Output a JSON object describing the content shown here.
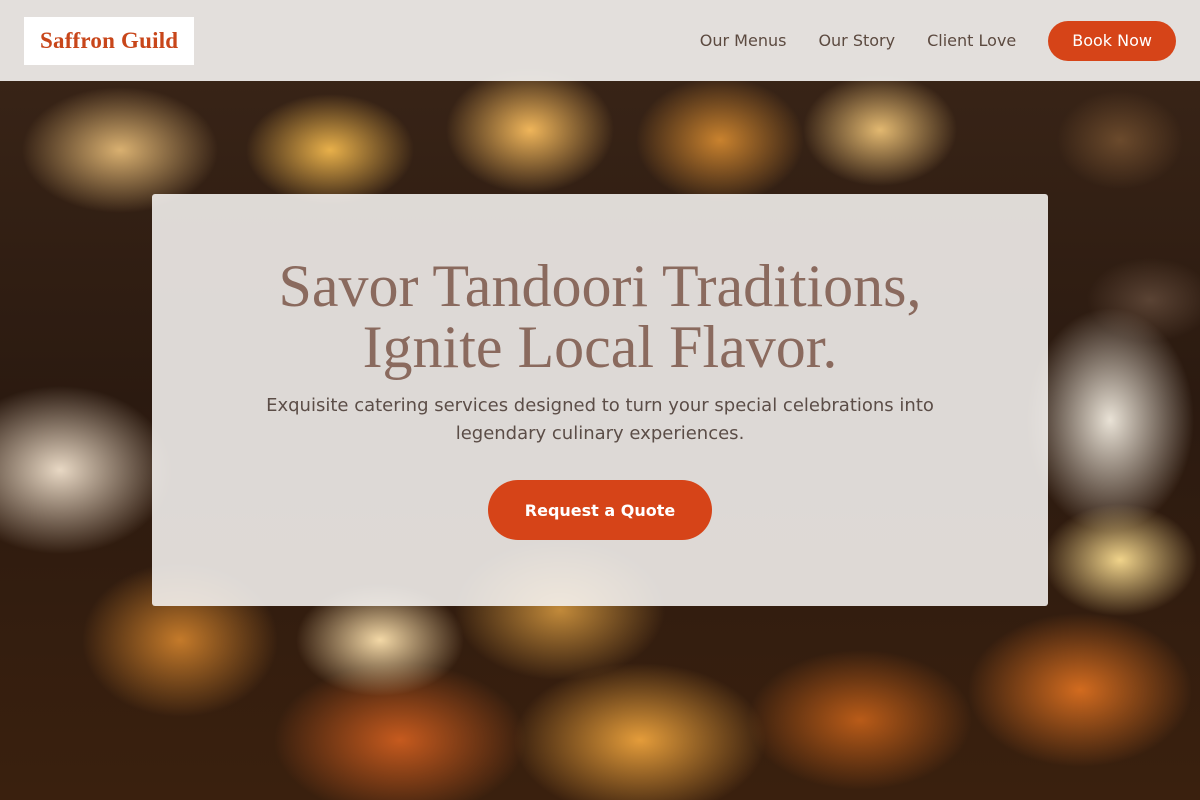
{
  "header": {
    "logo": "Saffron Guild",
    "nav": [
      {
        "label": "Our Menus"
      },
      {
        "label": "Our Story"
      },
      {
        "label": "Client Love"
      }
    ],
    "cta_label": "Book Now"
  },
  "hero": {
    "title_line1": "Savor Tandoori Traditions,",
    "title_line2": "Ignite Local Flavor.",
    "subtitle": "Exquisite catering services designed to turn your special celebrations into legendary culinary experiences.",
    "cta_label": "Request a Quote",
    "background_image": "catering-food-platter-photo"
  },
  "colors": {
    "accent": "#d64418",
    "logo": "#c8461a",
    "heading": "#8a6a5e",
    "body_text": "#5b4d47"
  }
}
